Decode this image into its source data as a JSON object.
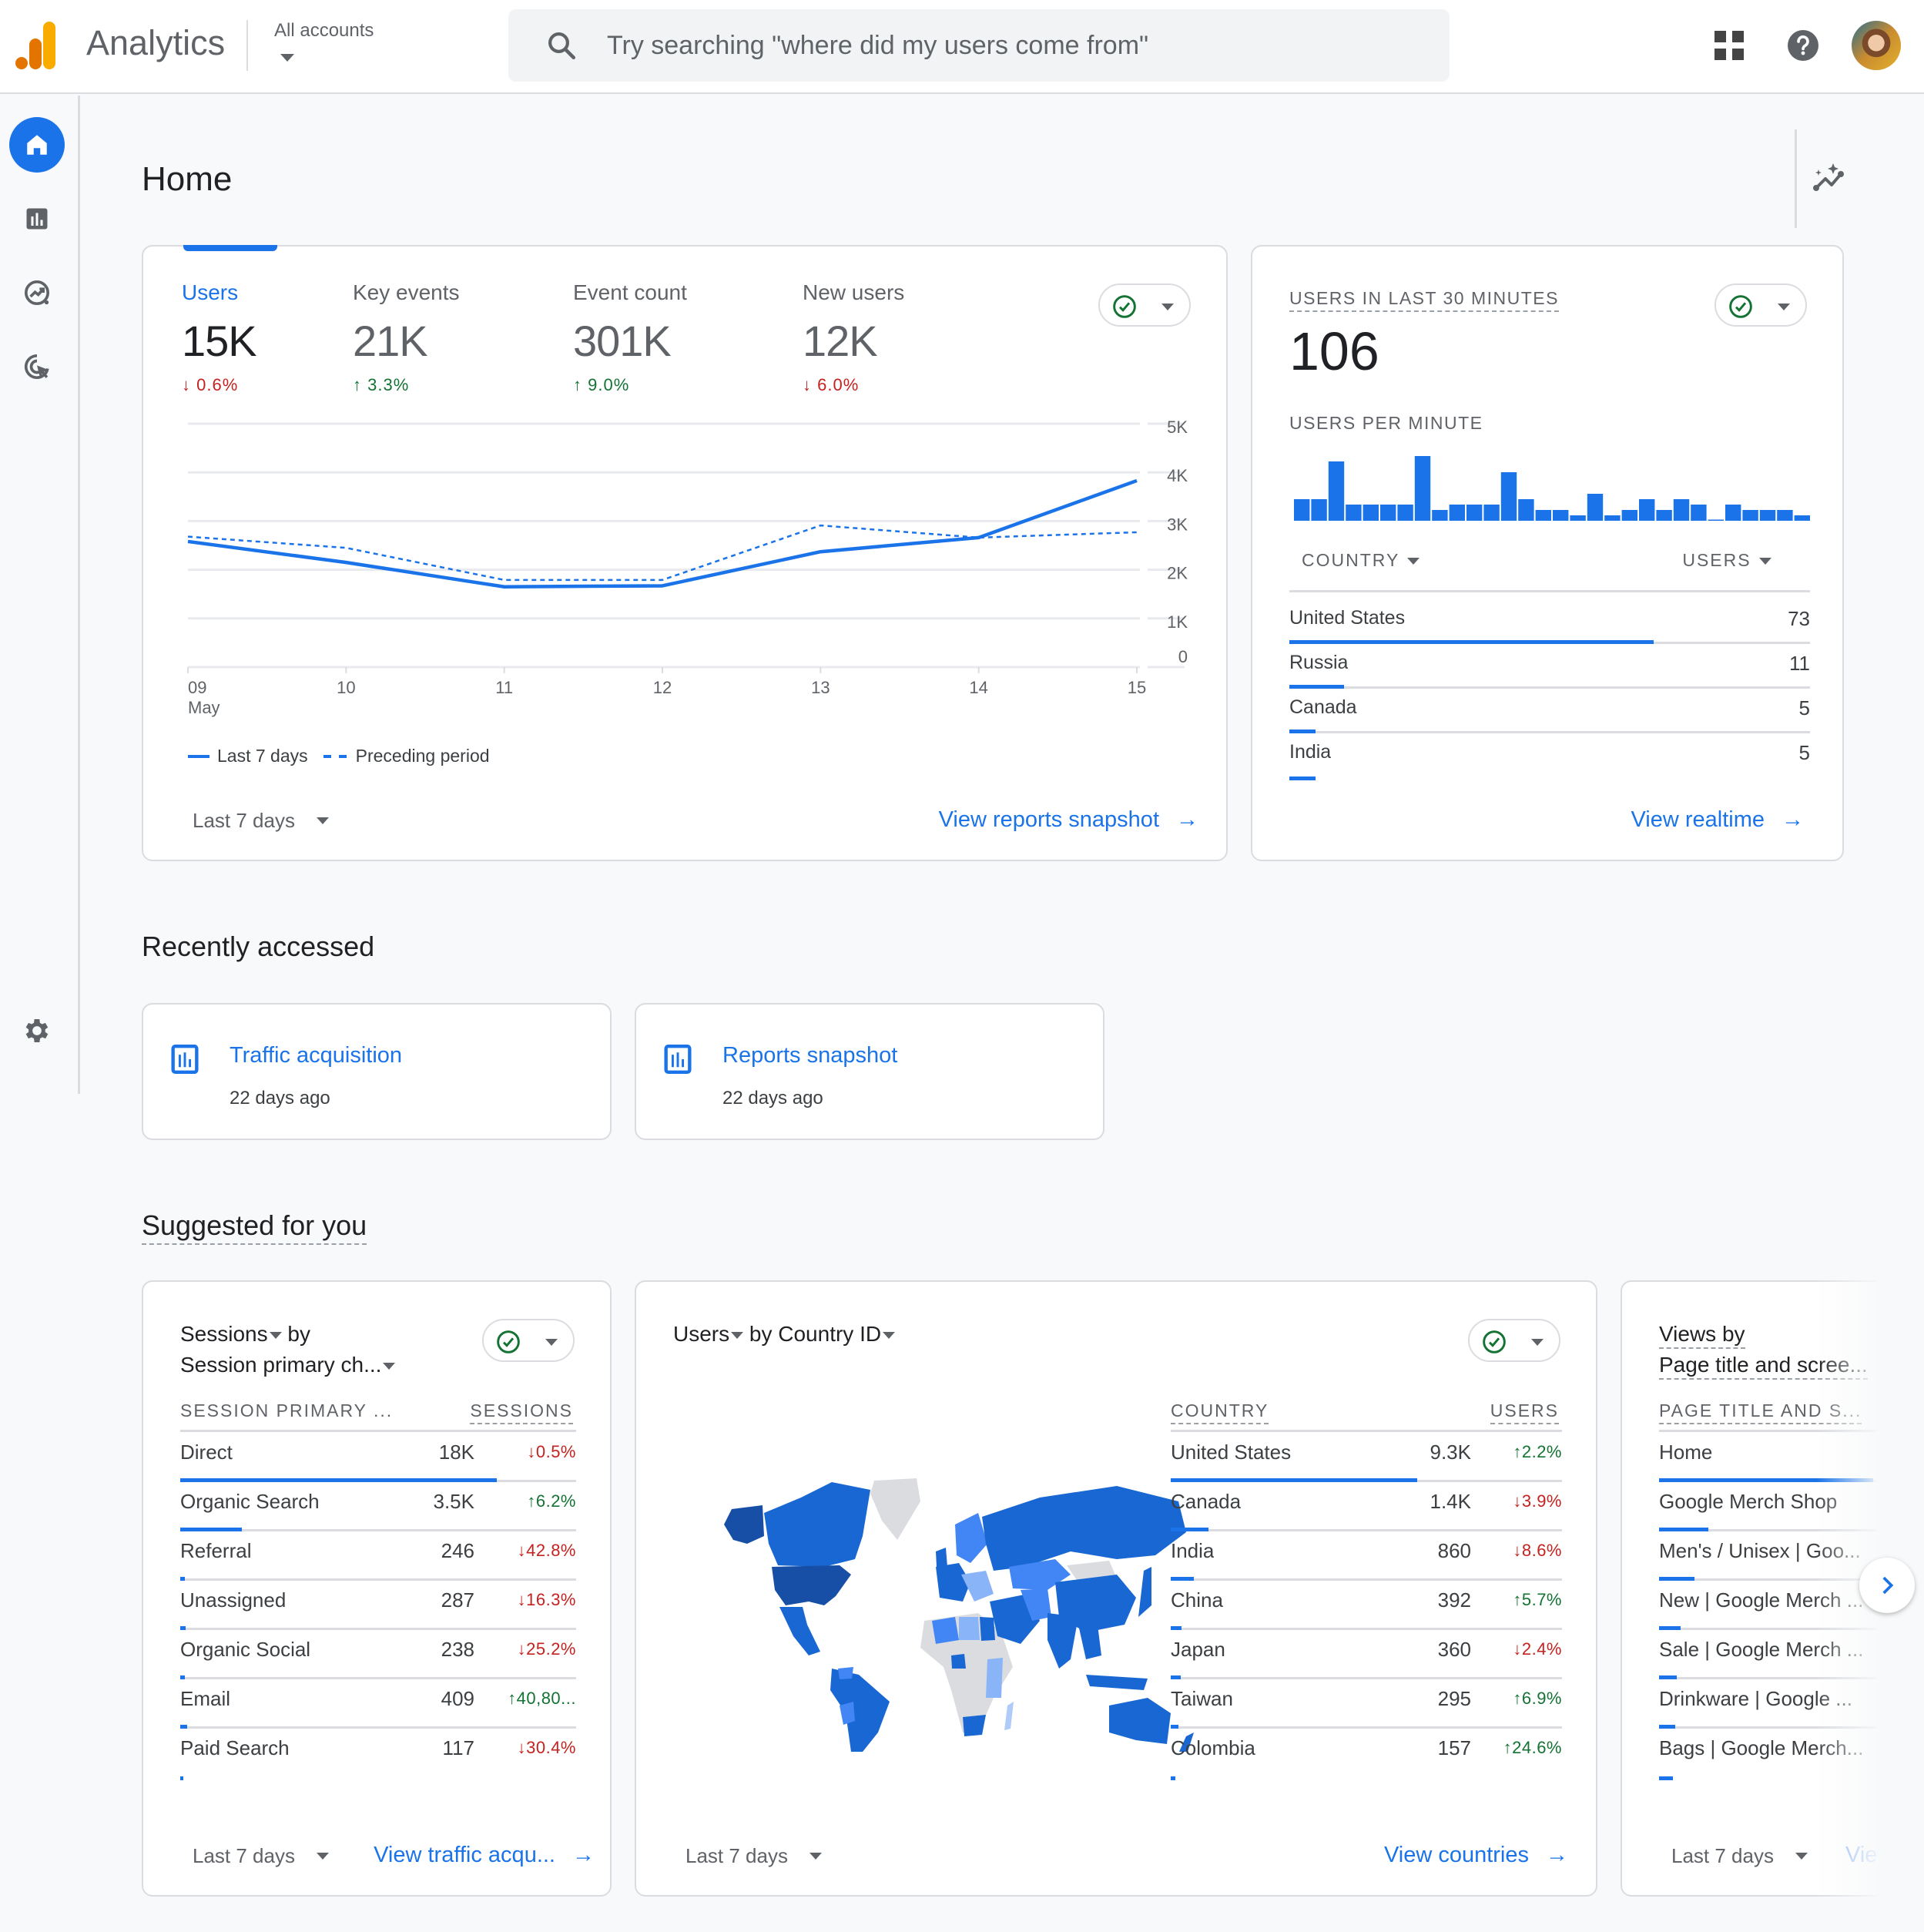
{
  "header": {
    "app_title": "Analytics",
    "account_selector": "All accounts",
    "search_placeholder": "Try searching \"where did my users come from\"",
    "icons": [
      "analytics-logo",
      "search-icon",
      "apps-grid-icon",
      "help-icon",
      "user-avatar"
    ]
  },
  "sidebar": {
    "items": [
      {
        "name": "Home",
        "icon": "home-icon",
        "active": true
      },
      {
        "name": "Reports",
        "icon": "reports-icon",
        "active": false
      },
      {
        "name": "Explore",
        "icon": "explore-icon",
        "active": false
      },
      {
        "name": "Advertising",
        "icon": "advertising-icon",
        "active": false
      },
      {
        "name": "Admin",
        "icon": "gear-icon",
        "active": false
      }
    ]
  },
  "page": {
    "title": "Home",
    "insights_icon": "insights-sparkle-icon"
  },
  "overview_card": {
    "metrics": [
      {
        "label": "Users",
        "value": "15K",
        "delta": "0.6%",
        "direction": "down",
        "active": true
      },
      {
        "label": "Key events",
        "value": "21K",
        "delta": "3.3%",
        "direction": "up",
        "active": false
      },
      {
        "label": "Event count",
        "value": "301K",
        "delta": "9.0%",
        "direction": "up",
        "active": false
      },
      {
        "label": "New users",
        "value": "12K",
        "delta": "6.0%",
        "direction": "down",
        "active": false
      }
    ],
    "legend": {
      "current": "Last 7 days",
      "previous": "Preceding period"
    },
    "date_range": "Last 7 days",
    "link": "View reports snapshot"
  },
  "chart_data": {
    "type": "line",
    "title": "Users",
    "x": [
      "09",
      "10",
      "11",
      "12",
      "13",
      "14",
      "15"
    ],
    "x_sublabel": "May",
    "xlabel": "",
    "ylabel": "",
    "ylim": [
      0,
      5000
    ],
    "yticks": [
      "0",
      "1K",
      "2K",
      "3K",
      "4K",
      "5K"
    ],
    "ytick_values": [
      0,
      1000,
      2000,
      3000,
      4000,
      5000
    ],
    "grid": true,
    "legend_position": "bottom-left",
    "series": [
      {
        "name": "Last 7 days",
        "style": "solid",
        "color": "#1a73e8",
        "values": [
          2580,
          2150,
          1650,
          1670,
          2370,
          2660,
          3830
        ]
      },
      {
        "name": "Preceding period",
        "style": "dashed",
        "color": "#1a73e8",
        "values": [
          2680,
          2450,
          1790,
          1790,
          2910,
          2660,
          2770
        ]
      }
    ]
  },
  "realtime_card": {
    "title": "USERS IN LAST 30 MINUTES",
    "value": "106",
    "per_minute_label": "USERS PER MINUTE",
    "per_minute": [
      4,
      4,
      11,
      3,
      3,
      3,
      3,
      12,
      2,
      3,
      3,
      3,
      9,
      4,
      2,
      2,
      1,
      5,
      1,
      2,
      4,
      2,
      4,
      3,
      0,
      3,
      2,
      2,
      2,
      1
    ],
    "col_country": "COUNTRY",
    "col_users": "USERS",
    "rows": [
      {
        "country": "United States",
        "users": "73",
        "share": 0.7
      },
      {
        "country": "Russia",
        "users": "11",
        "share": 0.105
      },
      {
        "country": "Canada",
        "users": "5",
        "share": 0.05
      },
      {
        "country": "India",
        "users": "5",
        "share": 0.05
      }
    ],
    "link": "View realtime"
  },
  "recently_accessed": {
    "title": "Recently accessed",
    "items": [
      {
        "title": "Traffic acquisition",
        "when": "22 days ago"
      },
      {
        "title": "Reports snapshot",
        "when": "22 days ago"
      }
    ]
  },
  "suggested": {
    "title": "Suggested for you",
    "sessions_card": {
      "metric": "Sessions",
      "by": "by",
      "dimension": "Session primary ch...",
      "col_dim": "SESSION PRIMARY ...",
      "col_metric": "SESSIONS",
      "rows": [
        {
          "name": "Direct",
          "value": "18K",
          "delta": "0.5%",
          "direction": "down",
          "share": 0.8
        },
        {
          "name": "Organic Search",
          "value": "3.5K",
          "delta": "6.2%",
          "direction": "up",
          "share": 0.155
        },
        {
          "name": "Referral",
          "value": "246",
          "delta": "42.8%",
          "direction": "down",
          "share": 0.012
        },
        {
          "name": "Unassigned",
          "value": "287",
          "delta": "16.3%",
          "direction": "down",
          "share": 0.013
        },
        {
          "name": "Organic Social",
          "value": "238",
          "delta": "25.2%",
          "direction": "down",
          "share": 0.011
        },
        {
          "name": "Email",
          "value": "409",
          "delta": "40,80...",
          "direction": "up",
          "share": 0.018
        },
        {
          "name": "Paid Search",
          "value": "117",
          "delta": "30.4%",
          "direction": "down",
          "share": 0.005
        }
      ],
      "date_range": "Last 7 days",
      "link": "View traffic acqu..."
    },
    "country_card": {
      "metric": "Users",
      "by": "by",
      "dimension": "Country ID",
      "col_dim": "COUNTRY",
      "col_metric": "USERS",
      "map_legend": {
        "high": "#174ea6",
        "mid": "#1967d2",
        "low": "#4285f4",
        "lowest": "#aecbfa",
        "none": "#dadce0"
      },
      "rows": [
        {
          "name": "United States",
          "value": "9.3K",
          "delta": "2.2%",
          "direction": "up",
          "share": 0.63
        },
        {
          "name": "Canada",
          "value": "1.4K",
          "delta": "3.9%",
          "direction": "down",
          "share": 0.097
        },
        {
          "name": "India",
          "value": "860",
          "delta": "8.6%",
          "direction": "down",
          "share": 0.06
        },
        {
          "name": "China",
          "value": "392",
          "delta": "5.7%",
          "direction": "up",
          "share": 0.027
        },
        {
          "name": "Japan",
          "value": "360",
          "delta": "2.4%",
          "direction": "down",
          "share": 0.025
        },
        {
          "name": "Taiwan",
          "value": "295",
          "delta": "6.9%",
          "direction": "up",
          "share": 0.02
        },
        {
          "name": "Colombia",
          "value": "157",
          "delta": "24.6%",
          "direction": "up",
          "share": 0.011
        }
      ],
      "date_range": "Last 7 days",
      "link": "View countries"
    },
    "views_card": {
      "metric": "Views by",
      "dimension": "Page title and scree...",
      "col_dim": "PAGE TITLE AND S...",
      "rows": [
        {
          "name": "Home",
          "share": 0.54
        },
        {
          "name": "Google Merch Shop",
          "share": 0.125
        },
        {
          "name": "Men's / Unisex | Goo...",
          "share": 0.09
        },
        {
          "name": "New | Google Merch ...",
          "share": 0.055
        },
        {
          "name": "Sale | Google Merch ...",
          "share": 0.045
        },
        {
          "name": "Drinkware | Google ...",
          "share": 0.04
        },
        {
          "name": "Bags | Google Merch...",
          "share": 0.035
        }
      ],
      "date_range": "Last 7 days",
      "link": "Vie"
    },
    "next_icon": "chevron-right-icon"
  }
}
